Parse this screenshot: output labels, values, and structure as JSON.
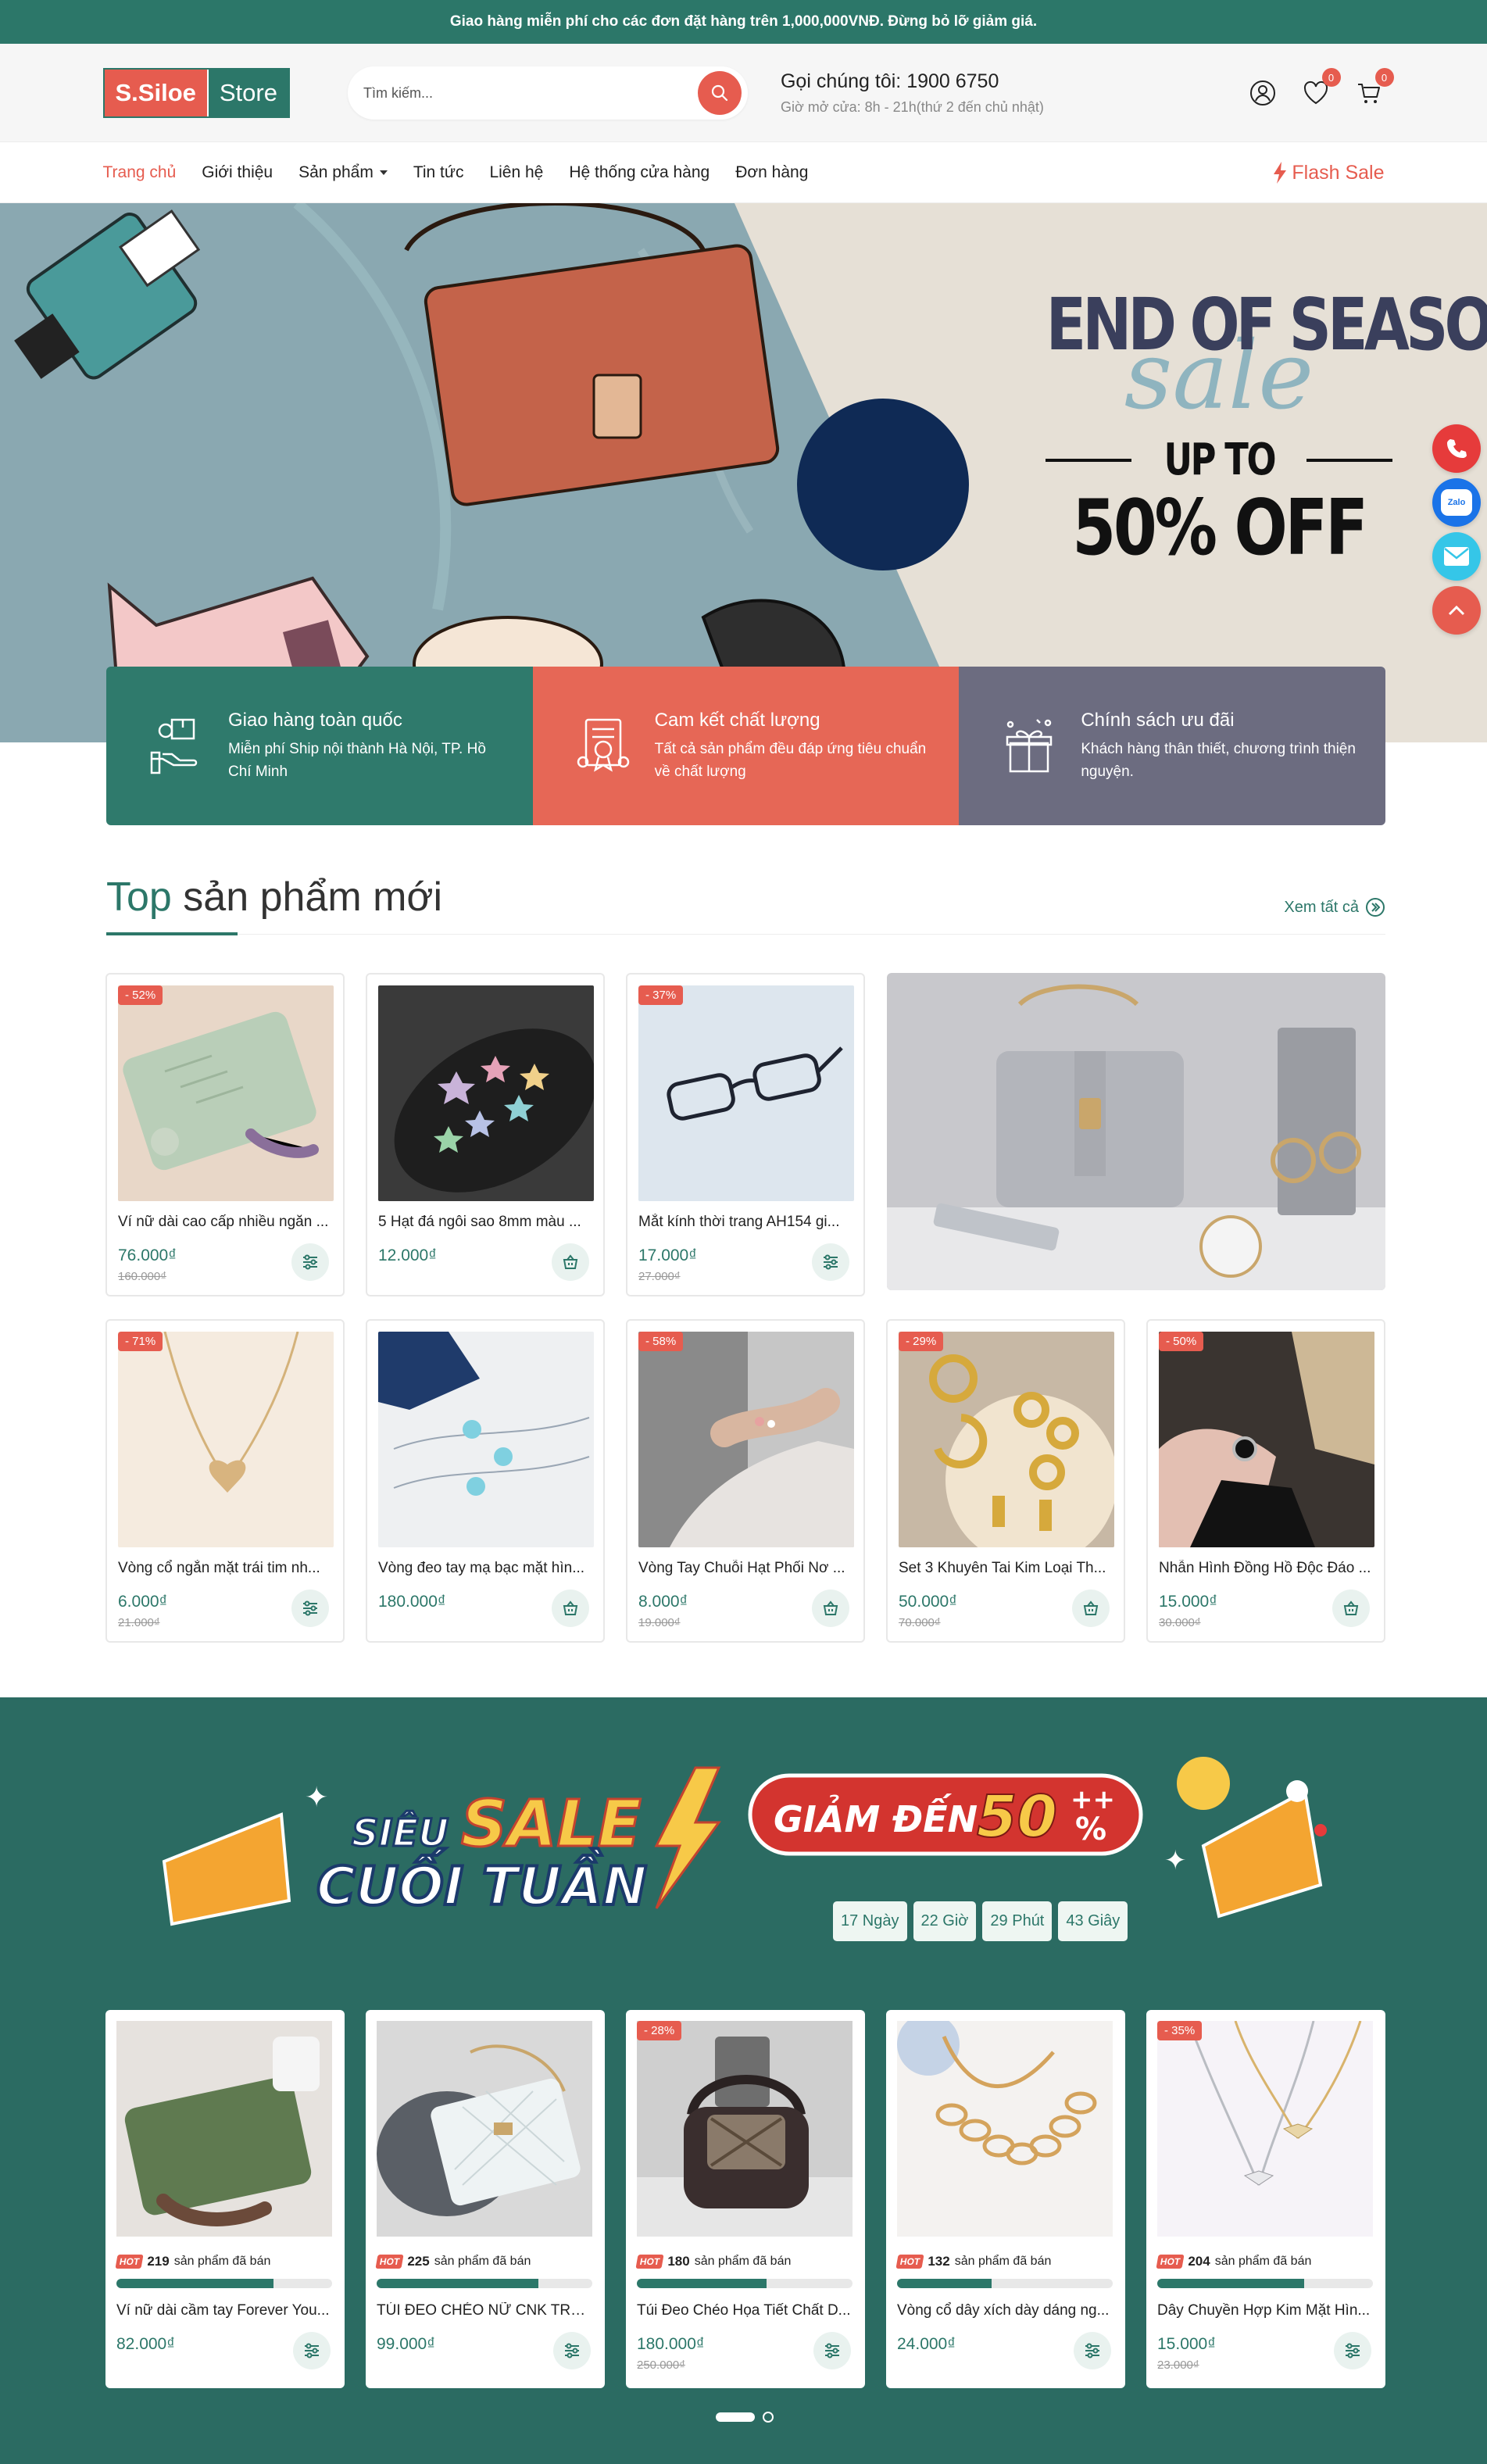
{
  "topbar": {
    "text": "Giao hàng miễn phí cho các đơn đặt hàng trên 1,000,000VNĐ. Đừng bỏ lỡ giảm giá."
  },
  "header": {
    "logo_left": "S.Siloe",
    "logo_right": "Store",
    "search_placeholder": "Tìm kiếm...",
    "hotline_label": "Gọi chúng tôi: 1900 6750",
    "hours": "Giờ mở cửa: 8h - 21h(thứ 2 đến chủ nhật)",
    "wishlist_count": "0",
    "cart_count": "0"
  },
  "nav": {
    "items": [
      {
        "label": "Trang chủ"
      },
      {
        "label": "Giới thiệu"
      },
      {
        "label": "Sản phẩm"
      },
      {
        "label": "Tin tức"
      },
      {
        "label": "Liên hệ"
      },
      {
        "label": "Hệ thống cửa hàng"
      },
      {
        "label": "Đơn hàng"
      }
    ],
    "flash_sale": "Flash Sale"
  },
  "banner": {
    "line1": "END OF SEASON",
    "line2": "sale",
    "line3": "UP TO",
    "line4": "50% OFF"
  },
  "features": [
    {
      "title": "Giao hàng toàn quốc",
      "desc": "Miễn phí Ship nội thành Hà Nội, TP. Hồ Chí Minh",
      "color": "#2f7a6c"
    },
    {
      "title": "Cam kết chất lượng",
      "desc": "Tất cả sản phẩm đều đáp ứng tiêu chuẩn về chất lượng",
      "color": "#e66756"
    },
    {
      "title": "Chính sách ưu đãi",
      "desc": "Khách hàng thân thiết, chương trình thiện nguyện.",
      "color": "#6c6c80"
    }
  ],
  "top_products": {
    "title_accent": "Top",
    "title_rest": "sản phẩm mới",
    "see_all": "Xem tất cả",
    "items": [
      {
        "name": "Ví nữ dài cao cấp nhiều ngăn ...",
        "price": "76.000₫",
        "old": "160.000₫",
        "discount": "- 52%"
      },
      {
        "name": "5 Hạt đá ngôi sao 8mm màu ...",
        "price": "12.000₫",
        "old": "",
        "discount": ""
      },
      {
        "name": "Mắt kính thời trang AH154 gi...",
        "price": "17.000₫",
        "old": "27.000₫",
        "discount": "- 37%"
      },
      {
        "name": "Vòng cổ ngắn mặt trái tim nh...",
        "price": "6.000₫",
        "old": "21.000₫",
        "discount": "- 71%"
      },
      {
        "name": "Vòng đeo tay mạ bạc mặt hìn...",
        "price": "180.000₫",
        "old": "",
        "discount": ""
      },
      {
        "name": "Vòng Tay Chuỗi Hạt Phối Nơ ...",
        "price": "8.000₫",
        "old": "19.000₫",
        "discount": "- 58%"
      },
      {
        "name": "Set 3 Khuyên Tai Kim Loại Th...",
        "price": "50.000₫",
        "old": "70.000₫",
        "discount": "- 29%"
      },
      {
        "name": "Nhẫn Hình Đồng Hồ Độc Đáo ...",
        "price": "15.000₫",
        "old": "30.000₫",
        "discount": "- 50%"
      }
    ]
  },
  "flash_sale": {
    "banner_w1": "SIÊU",
    "banner_w2": "SALE",
    "banner_w3": "CUỐI TUẦN",
    "banner_w4": "GIẢM ĐẾN",
    "banner_w5": "50",
    "banner_w6": "++",
    "banner_w7": "%",
    "timer": [
      "17 Ngày",
      "22 Giờ",
      "29 Phút",
      "43 Giây"
    ],
    "sold_suffix": "sản phẩm đã bán",
    "hot_label": "HOT",
    "items": [
      {
        "name": "Ví nữ dài cầm tay Forever You...",
        "price": "82.000₫",
        "old": "",
        "discount": "",
        "sold": "219",
        "progress": 0.73
      },
      {
        "name": "TÚI ĐEO CHÉO NỮ CNK TRẦN...",
        "price": "99.000₫",
        "old": "",
        "discount": "",
        "sold": "225",
        "progress": 0.75
      },
      {
        "name": "Túi Đeo Chéo Họa Tiết Chất D...",
        "price": "180.000₫",
        "old": "250.000₫",
        "discount": "- 28%",
        "sold": "180",
        "progress": 0.6
      },
      {
        "name": "Vòng cổ dây xích dày dáng ng...",
        "price": "24.000₫",
        "old": "",
        "discount": "",
        "sold": "132",
        "progress": 0.44
      },
      {
        "name": "Dây Chuyền Hợp Kim Mặt Hìn...",
        "price": "15.000₫",
        "old": "23.000₫",
        "discount": "- 35%",
        "sold": "204",
        "progress": 0.68
      }
    ]
  },
  "float_widgets": {
    "zalo": "Zalo"
  }
}
